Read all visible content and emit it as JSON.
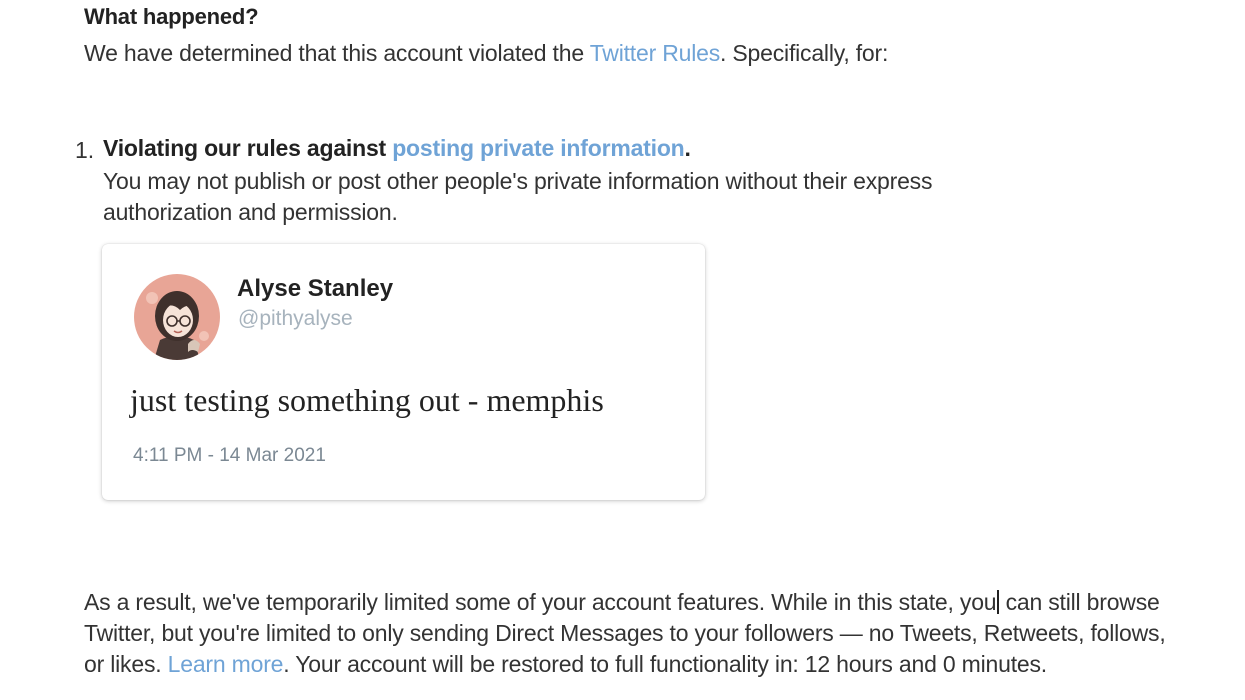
{
  "what_happened": {
    "title": "What happened?",
    "intro_before": "We have determined that this account violated the ",
    "intro_link": "Twitter Rules",
    "intro_after": ". Specifically, for:"
  },
  "violation": {
    "number": "1.",
    "title_before": "Violating our rules against ",
    "title_link": "posting private information",
    "title_after": ".",
    "description": "You may not publish or post other people's private information without their express authorization and permission."
  },
  "tweet": {
    "author_name": "Alyse Stanley",
    "author_handle": "@pithyalyse",
    "avatar": "user-avatar",
    "text": "just testing something out - memphis",
    "timestamp": "4:11 PM - 14 Mar 2021"
  },
  "result": {
    "text_1": "As a result, we've temporarily limited some of your account features. While in this state, you",
    "text_2": " can still browse Twitter, but you're limited to only sending Direct Messages to your followers — no Tweets, Retweets, follows, or likes. ",
    "learn_more": "Learn more",
    "text_3": ". Your account will be restored to full functionality in: 12 hours and 0 minutes."
  },
  "colors": {
    "link": "#6fa3d6",
    "handle": "#a7b3bd",
    "timestamp": "#7b8893"
  }
}
